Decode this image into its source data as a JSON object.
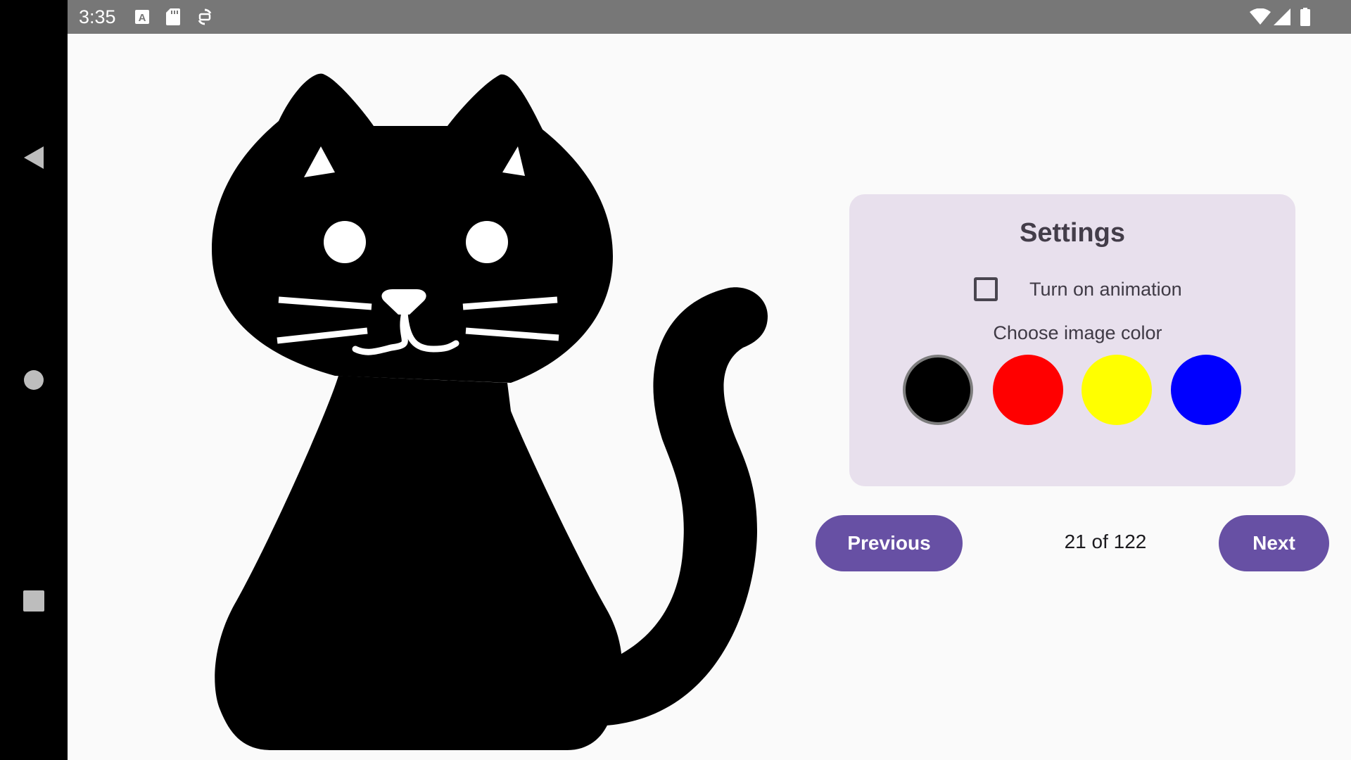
{
  "status_bar": {
    "time": "3:35",
    "left_icons": [
      "font-download-icon",
      "sd-card-icon",
      "sync-icon"
    ],
    "right_icons": [
      "wifi-icon",
      "cell-signal-icon",
      "battery-icon"
    ]
  },
  "nav_bar": {
    "buttons": [
      "back-icon",
      "home-icon",
      "recents-icon"
    ]
  },
  "image": {
    "subject": "cat-silhouette",
    "color": "#000000"
  },
  "settings": {
    "title": "Settings",
    "animation_label": "Turn on animation",
    "animation_checked": false,
    "color_label": "Choose image color",
    "colors": [
      {
        "name": "black",
        "hex": "#000000",
        "selected": true
      },
      {
        "name": "red",
        "hex": "#ff0000",
        "selected": false
      },
      {
        "name": "yellow",
        "hex": "#ffff00",
        "selected": false
      },
      {
        "name": "blue",
        "hex": "#0000ff",
        "selected": false
      }
    ]
  },
  "pager": {
    "previous_label": "Previous",
    "indicator": "21 of 122",
    "next_label": "Next"
  },
  "theme": {
    "primary": "#6750a4",
    "card_background": "#e8e0ed",
    "screen_background": "#fafafa",
    "status_bar": "#777777"
  }
}
